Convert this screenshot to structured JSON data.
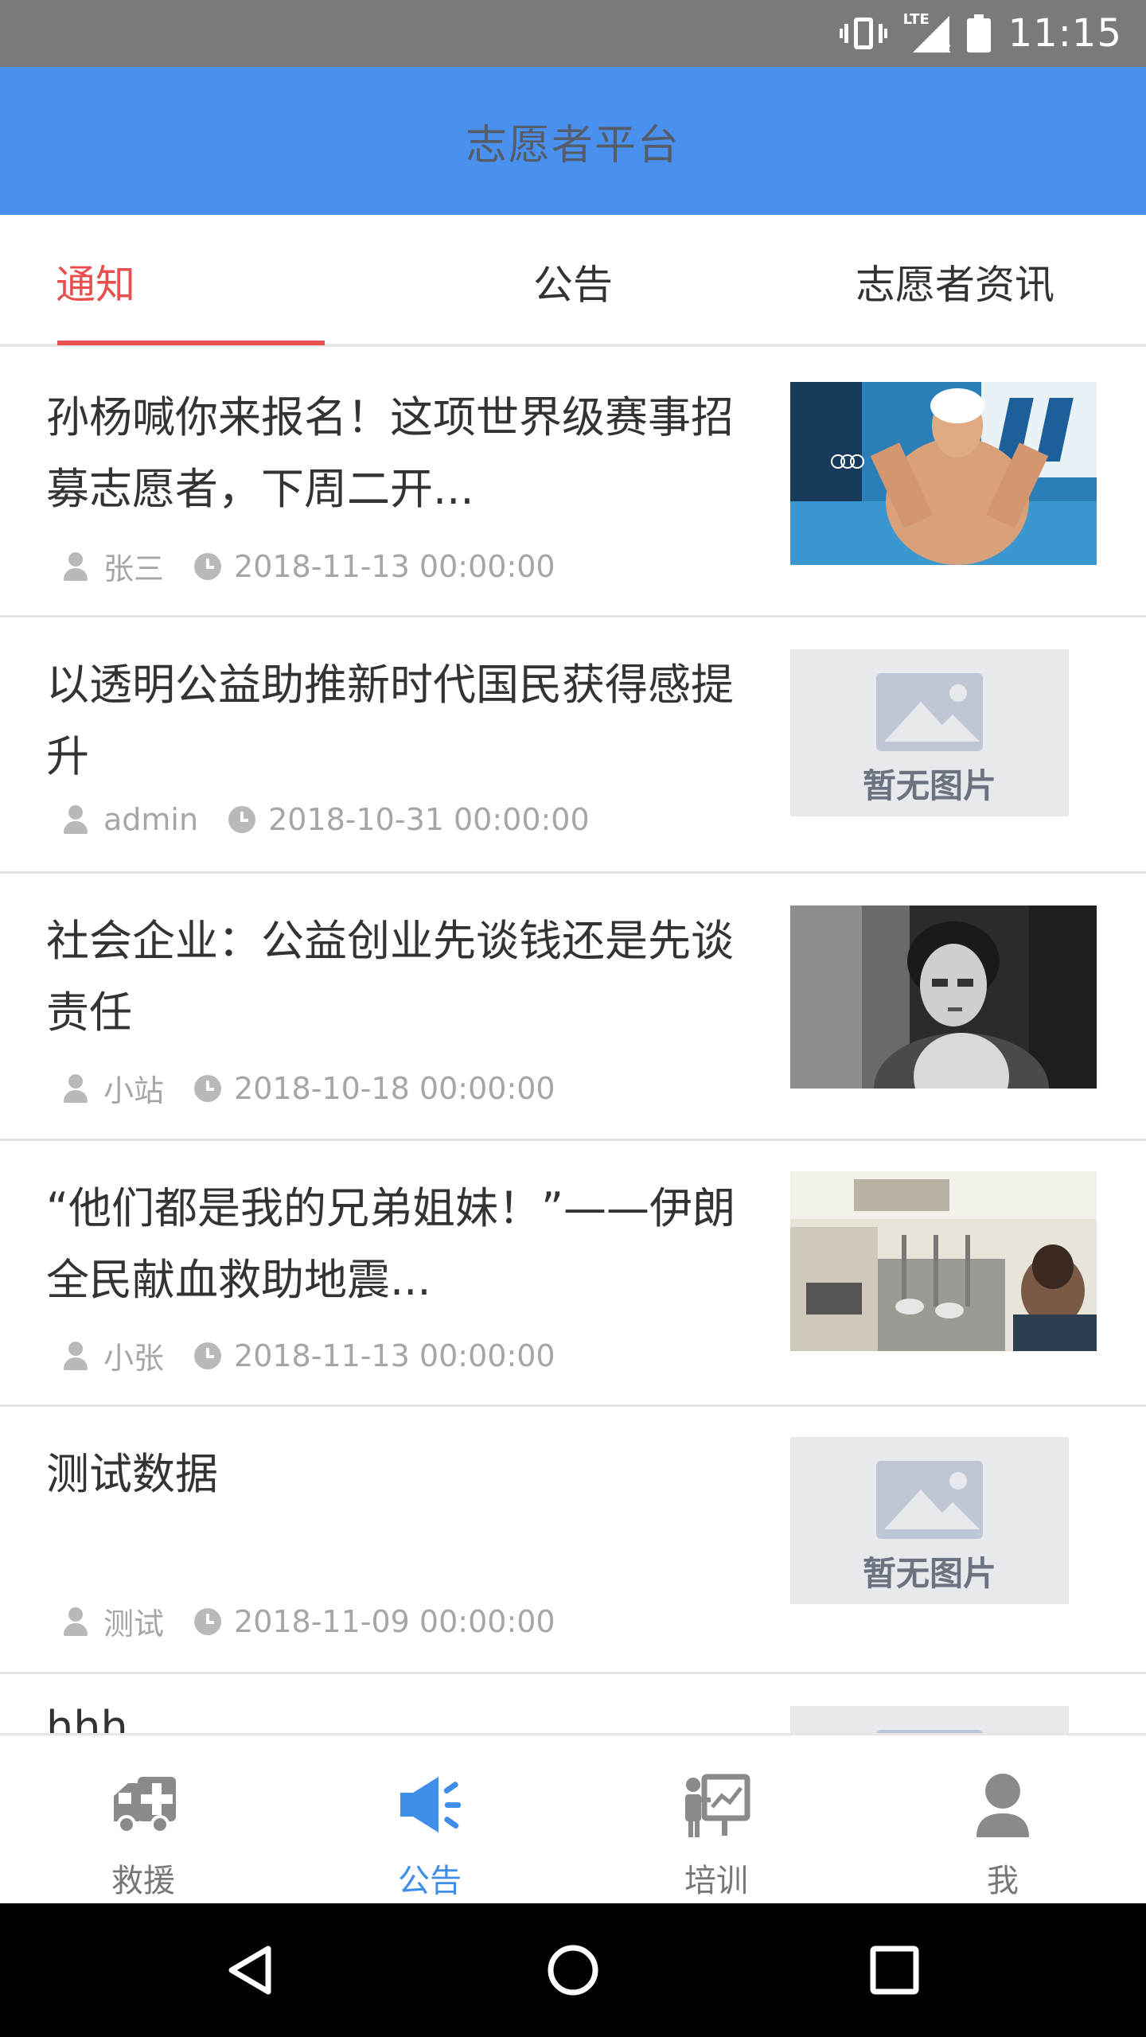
{
  "status_bar": {
    "time": "11:15",
    "network_label": "LTE"
  },
  "header": {
    "title": "志愿者平台",
    "background_color": "#4a90ee"
  },
  "tabs": [
    {
      "label": "通知",
      "active": true
    },
    {
      "label": "公告",
      "active": false
    },
    {
      "label": "志愿者资讯",
      "active": false
    }
  ],
  "accent_color": "#e8504f",
  "no_image_caption": "暂无图片",
  "articles": [
    {
      "title": "孙杨喊你来报名！这项世界级赛事招募志愿者，下周二开...",
      "author": "张三",
      "date": "2018-11-13 00:00:00",
      "image": "photo"
    },
    {
      "title": "以透明公益助推新时代国民获得感提升",
      "author": "admin",
      "date": "2018-10-31 00:00:00",
      "image": "none"
    },
    {
      "title": "社会企业：公益创业先谈钱还是先谈责任",
      "author": "小站",
      "date": "2018-10-18 00:00:00",
      "image": "photo"
    },
    {
      "title": "“他们都是我的兄弟姐妹！”——伊朗全民献血救助地震...",
      "author": "小张",
      "date": "2018-11-13 00:00:00",
      "image": "photo"
    },
    {
      "title": "测试数据",
      "author": "测试",
      "date": "2018-11-09 00:00:00",
      "image": "none"
    },
    {
      "title": "hhh",
      "image": "none"
    }
  ],
  "bottom_nav": [
    {
      "label": "救援",
      "icon": "ambulance-icon",
      "active": false
    },
    {
      "label": "公告",
      "icon": "megaphone-icon",
      "active": true
    },
    {
      "label": "培训",
      "icon": "training-icon",
      "active": false
    },
    {
      "label": "我",
      "icon": "person-icon",
      "active": false
    }
  ],
  "nav_active_color": "#3f8ee8"
}
